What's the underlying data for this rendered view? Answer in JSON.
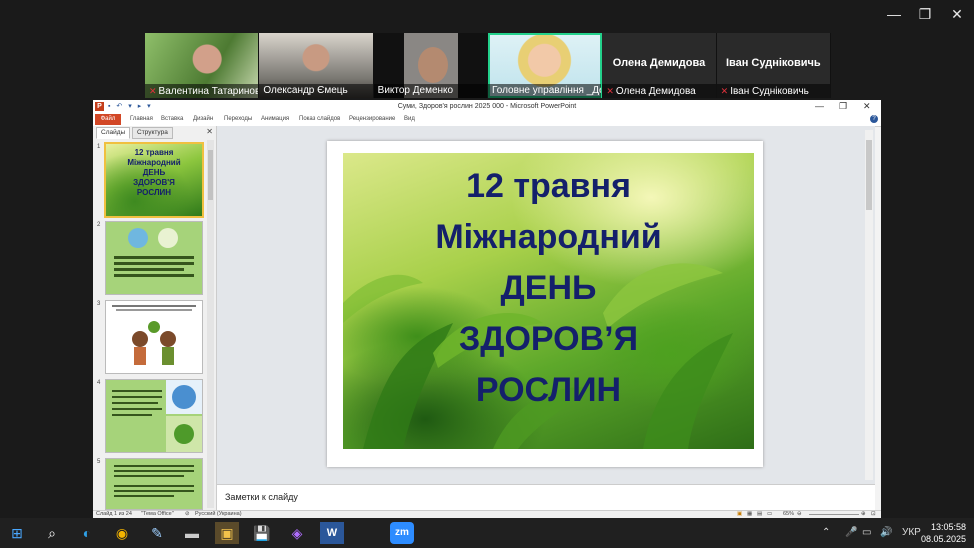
{
  "window_controls": {
    "minimize": "—",
    "restore": "❐",
    "close": "✕"
  },
  "zoom": {
    "participants": [
      {
        "name": "Валентина Татаринова",
        "muted": true,
        "video": true
      },
      {
        "name": "Олександр Ємець",
        "muted": false,
        "video": true
      },
      {
        "name": "Виктор Деменко",
        "muted": false,
        "video": true
      },
      {
        "name": "Головне управління _Де...",
        "muted": false,
        "video": true,
        "active": true
      },
      {
        "name": "Олена Демидова",
        "muted": true,
        "video": false
      },
      {
        "name": "Іван Судніковичь",
        "muted": true,
        "video": false
      }
    ]
  },
  "powerpoint": {
    "title": "Суми, Здоров'я рослин 2025 000  -  Microsoft PowerPoint",
    "quick_access": "▪ ↶ ▾ ▸ ▾",
    "ribbon_tabs": [
      "Файл",
      "Главная",
      "Вставка",
      "Дизайн",
      "Переходы",
      "Анимация",
      "Показ слайдов",
      "Рецензирование",
      "Вид"
    ],
    "panel_tabs": [
      "Слайды",
      "Структура"
    ],
    "slide_numbers": [
      "1",
      "2",
      "3",
      "4",
      "5"
    ],
    "thumb1_title": [
      "12 травня",
      "Міжнародний",
      "ДЕНЬ",
      "ЗДОРОВ'Я",
      "РОСЛИН"
    ],
    "slide_title": [
      "12 травня",
      "Міжнародний",
      "ДЕНЬ",
      "ЗДОРОВ’Я",
      "РОСЛИН"
    ],
    "notes_placeholder": "Заметки к слайду",
    "status": {
      "slide": "Слайд 1 из 24",
      "theme": "\"Тема Office\"",
      "language": "Русский (Украина)",
      "zoom": "65%"
    }
  },
  "taskbar": {
    "apps": [
      "⊞",
      "⌕",
      "◐",
      "◉",
      "✎",
      "▬",
      "▣",
      "💾",
      "◈",
      "W",
      "zm"
    ],
    "tray": [
      "⌃",
      "🎤",
      "▭",
      "🔊"
    ],
    "language": "УКР",
    "time": "13:05:58",
    "date": "08.05.2025"
  }
}
